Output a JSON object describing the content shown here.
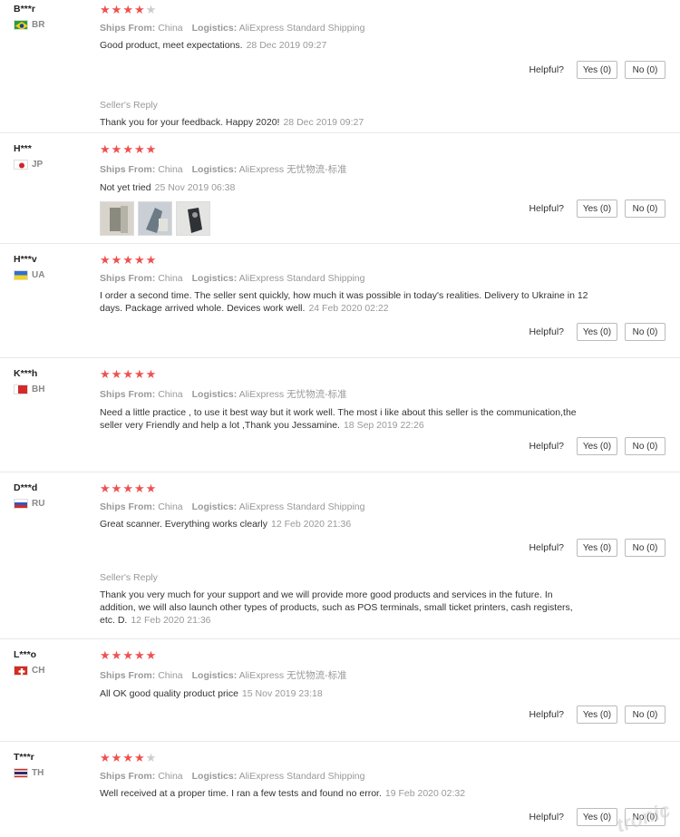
{
  "ui": {
    "helpful_label": "Helpful?",
    "seller_reply_label": "Seller's Reply",
    "ships_from_label": "Ships From:",
    "logistics_label": "Logistics:"
  },
  "reviews": [
    {
      "user": "B***r",
      "country": "BR",
      "stars": 4,
      "ships_from": "China",
      "logistics": "AliExpress Standard Shipping",
      "text": "Good product, meet expectations.",
      "date": "28 Dec 2019 09:27",
      "yes": "Yes (0)",
      "no": "No (0)",
      "reply": {
        "text": "Thank you for your feedback. Happy 2020!",
        "date": "28 Dec 2019 09:27"
      }
    },
    {
      "user": "H***",
      "country": "JP",
      "stars": 5,
      "ships_from": "China",
      "logistics": "AliExpress 无忧物流-标准",
      "text": "Not yet tried",
      "date": "25 Nov 2019 06:38",
      "yes": "Yes (0)",
      "no": "No (0)"
    },
    {
      "user": "H***v",
      "country": "UA",
      "stars": 5,
      "ships_from": "China",
      "logistics": "AliExpress Standard Shipping",
      "text": "I order a second time. The seller sent quickly, how much it was possible in today's realities. Delivery to Ukraine in 12 days. Package arrived whole. Devices work well.",
      "date": "24 Feb 2020 02:22",
      "yes": "Yes (0)",
      "no": "No (0)"
    },
    {
      "user": "K***h",
      "country": "BH",
      "stars": 5,
      "ships_from": "China",
      "logistics": "AliExpress 无忧物流-标准",
      "text": "Need a little practice , to use it best way but it work well. The most i like about this seller is the communication,the seller very Friendly and help a lot ,Thank you Jessamine.",
      "date": "18 Sep 2019 22:26",
      "yes": "Yes (0)",
      "no": "No (0)"
    },
    {
      "user": "D***d",
      "country": "RU",
      "stars": 5,
      "ships_from": "China",
      "logistics": "AliExpress Standard Shipping",
      "text": "Great scanner. Everything works clearly",
      "date": "12 Feb 2020 21:36",
      "yes": "Yes (0)",
      "no": "No (0)",
      "reply": {
        "text": "Thank you very much for your support and we will provide more good products and services in the future. In addition, we will also launch other types of products, such as POS terminals, small ticket printers, cash registers, etc. D.",
        "date": "12 Feb 2020 21:36"
      }
    },
    {
      "user": "L***o",
      "country": "CH",
      "stars": 5,
      "ships_from": "China",
      "logistics": "AliExpress 无忧物流-标准",
      "text": "All OK good quality product price",
      "date": "15 Nov 2019 23:18",
      "yes": "Yes (0)",
      "no": "No (0)"
    },
    {
      "user": "T***r",
      "country": "TH",
      "stars": 4,
      "ships_from": "China",
      "logistics": "AliExpress Standard Shipping",
      "text": "Well received at a proper time. I ran a few tests and found no error.",
      "date": "19 Feb 2020 02:32",
      "yes": "Yes (0)",
      "no": "No (0)"
    }
  ],
  "watermark": "tronic"
}
